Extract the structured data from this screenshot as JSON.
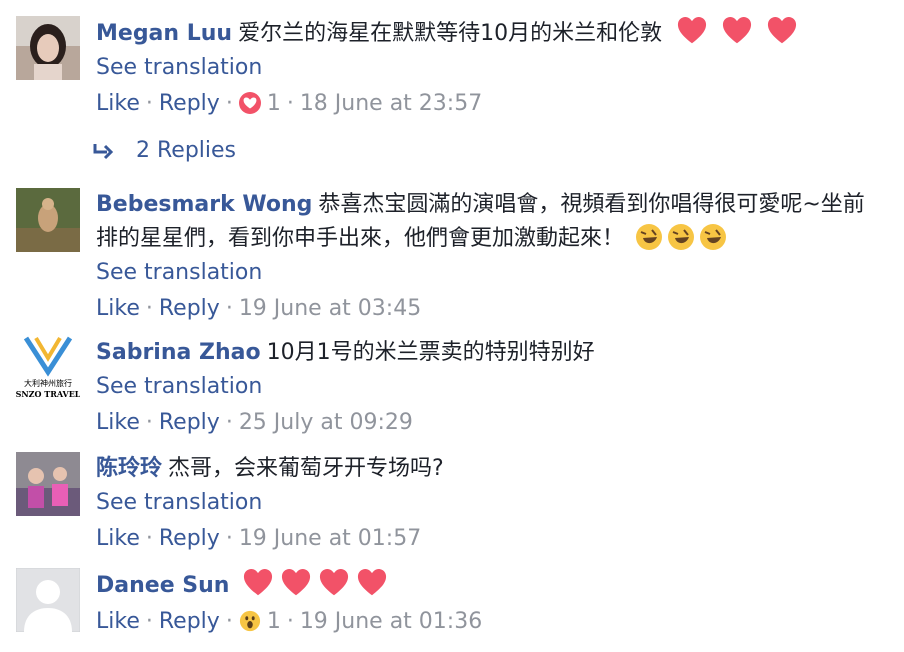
{
  "comments": [
    {
      "author": "Megan Luu",
      "text": "爱尔兰的海星在默默等待10月的米兰和伦敦",
      "text_line2": "",
      "see_translation": "See translation",
      "like": "Like",
      "reply": "Reply",
      "reaction_count": "1",
      "timestamp": "18 June at 23:57",
      "emojis": [
        "heart-icon",
        "heart-icon",
        "heart-icon"
      ],
      "reaction": "love-reaction-icon"
    },
    {
      "author": "Bebesmark Wong",
      "text": "恭喜杰宝圆滿的演唱會，視頻看到你唱得很可愛呢~坐前",
      "text_line2": "排的星星們，看到你申手出來，他們會更加激動起來！",
      "see_translation": "See translation",
      "like": "Like",
      "reply": "Reply",
      "timestamp": "19 June at 03:45",
      "emojis": [
        "rofl-emoji",
        "rofl-emoji",
        "rofl-emoji"
      ]
    },
    {
      "author": "Sabrina Zhao",
      "text": "10月1号的米兰票卖的特别特别好",
      "see_translation": "See translation",
      "like": "Like",
      "reply": "Reply",
      "timestamp": "25 July at 09:29",
      "avatar_logo_cn": "大利神州旅行",
      "avatar_logo_en": "SNZO TRAVEL"
    },
    {
      "author": "陈玲玲",
      "text": "杰哥，会来葡萄牙开专场吗?",
      "see_translation": "See translation",
      "like": "Like",
      "reply": "Reply",
      "timestamp": "19 June at 01:57"
    },
    {
      "author": "Danee Sun",
      "like": "Like",
      "reply": "Reply",
      "reaction_count": "1",
      "timestamp": "19 June at 01:36",
      "emojis": [
        "heart-icon",
        "heart-icon",
        "heart-icon",
        "heart-icon"
      ],
      "reaction": "wow-reaction-icon"
    }
  ],
  "replies_link": "2 Replies",
  "colors": {
    "link": "#385898",
    "meta": "#90949c",
    "text": "#1d2129",
    "heart": "#f25268"
  }
}
